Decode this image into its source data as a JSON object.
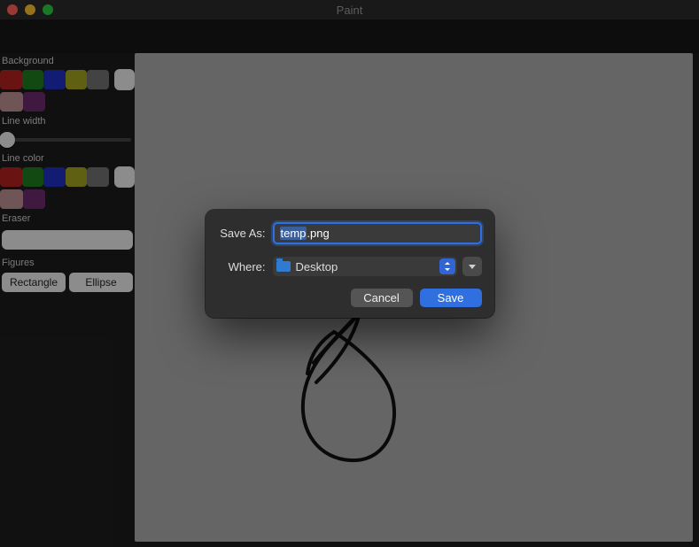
{
  "window": {
    "title": "Paint"
  },
  "sidebar": {
    "background_label": "Background",
    "line_width_label": "Line width",
    "line_color_label": "Line color",
    "eraser_label": "Eraser",
    "figures_label": "Figures",
    "figures": {
      "rectangle": "Rectangle",
      "ellipse": "Ellipse"
    },
    "palette_row1": [
      "#b02020",
      "#1f7a1f",
      "#2030c0",
      "#a0a020",
      "#707070"
    ],
    "palette_row2": [
      "#b98e8e",
      "#6a2a6a"
    ]
  },
  "dialog": {
    "save_as_label": "Save As:",
    "filename_selected": "temp",
    "filename_ext": ".png",
    "where_label": "Where:",
    "where_value": "Desktop",
    "cancel": "Cancel",
    "save": "Save"
  }
}
